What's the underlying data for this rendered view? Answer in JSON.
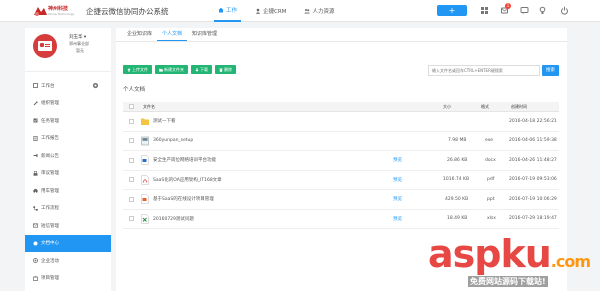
{
  "brand": {
    "logo_text": "神州科技",
    "logo_sub": "China Technology",
    "app_title": "企捷云微信协同办公系统"
  },
  "topnav": [
    {
      "label": "工作",
      "icon": "home-icon",
      "active": true
    },
    {
      "label": "企捷CRM",
      "icon": "user-icon",
      "active": false
    },
    {
      "label": "人力资源",
      "icon": "people-icon",
      "active": false
    }
  ],
  "toolbar_right": {
    "plus_label": "+",
    "badge_count": "1"
  },
  "user": {
    "name": "刘玉华 ▾",
    "dept": "郑州事业部",
    "status": "暂无"
  },
  "sidebar": [
    {
      "label": "工作台",
      "icon": "desk-icon",
      "active": false
    },
    {
      "label": "组织管理",
      "icon": "wrench-icon",
      "active": false
    },
    {
      "label": "任务管理",
      "icon": "task-icon",
      "active": false
    },
    {
      "label": "工作报告",
      "icon": "report-icon",
      "active": false
    },
    {
      "label": "新闻公告",
      "icon": "bullhorn-icon",
      "active": false
    },
    {
      "label": "审议管理",
      "icon": "vote-icon",
      "active": false
    },
    {
      "label": "用车管理",
      "icon": "car-icon",
      "active": false
    },
    {
      "label": "工作流程",
      "icon": "flow-icon",
      "active": false
    },
    {
      "label": "短信管理",
      "icon": "sms-icon",
      "active": false
    },
    {
      "label": "文档中心",
      "icon": "doc-center-icon",
      "active": true
    },
    {
      "label": "企业活动",
      "icon": "activity-icon",
      "active": false
    },
    {
      "label": "项目管理",
      "icon": "project-icon",
      "active": false
    }
  ],
  "tabs": [
    {
      "label": "企业知识库",
      "active": false
    },
    {
      "label": "个人文档",
      "active": true
    },
    {
      "label": "知识库管理",
      "active": false
    }
  ],
  "actions": [
    {
      "label": "上传文件",
      "icon": "upload-icon"
    },
    {
      "label": "新建文件夹",
      "icon": "folder-plus-icon"
    },
    {
      "label": "下载",
      "icon": "download-icon"
    },
    {
      "label": "删除",
      "icon": "trash-icon"
    }
  ],
  "search": {
    "placeholder": "输入文件名或回车CTRL+ENTER键搜索",
    "button": "搜索"
  },
  "section_title": "个人文档",
  "table": {
    "headers": [
      "文件名",
      "大小",
      "格式",
      "创建时间"
    ],
    "rows": [
      {
        "name": "测试一下看",
        "type": "folder",
        "preview": "",
        "size": "",
        "format": "",
        "created": "2016-04-18 22:56:21"
      },
      {
        "name": "360yunpan_setup",
        "type": "exe",
        "preview": "",
        "size": "7.98 MB",
        "format": "exe",
        "created": "2016-04-06 11:59:38"
      },
      {
        "name": "安全生产岗位网络培训平台功能",
        "type": "doc",
        "preview": "预览",
        "size": "26.86 KB",
        "format": "docx",
        "created": "2016-04-26 11:48:27"
      },
      {
        "name": "SaaS化的OA应用架构_IT168文章",
        "type": "pdf",
        "preview": "预览",
        "size": "1016.74 KB",
        "format": "pdf",
        "created": "2016-07-19 09:53:06"
      },
      {
        "name": "基于SaaS的在线设计项目管理",
        "type": "ppt",
        "preview": "预览",
        "size": "429.50 KB",
        "format": "ppt",
        "created": "2016-07-19 10:06:29"
      },
      {
        "name": "20160729测试问题",
        "type": "xls",
        "preview": "预览",
        "size": "18.49 KB",
        "format": "xlsx",
        "created": "2016-07-29 18:19:47"
      }
    ]
  },
  "watermark": {
    "main_a": "aspku",
    "main_b": ".com",
    "sub": "免费网站源码下载站!"
  },
  "colors": {
    "accent": "#2196f3",
    "green": "#22b573",
    "brand_red": "#d63c3c"
  }
}
